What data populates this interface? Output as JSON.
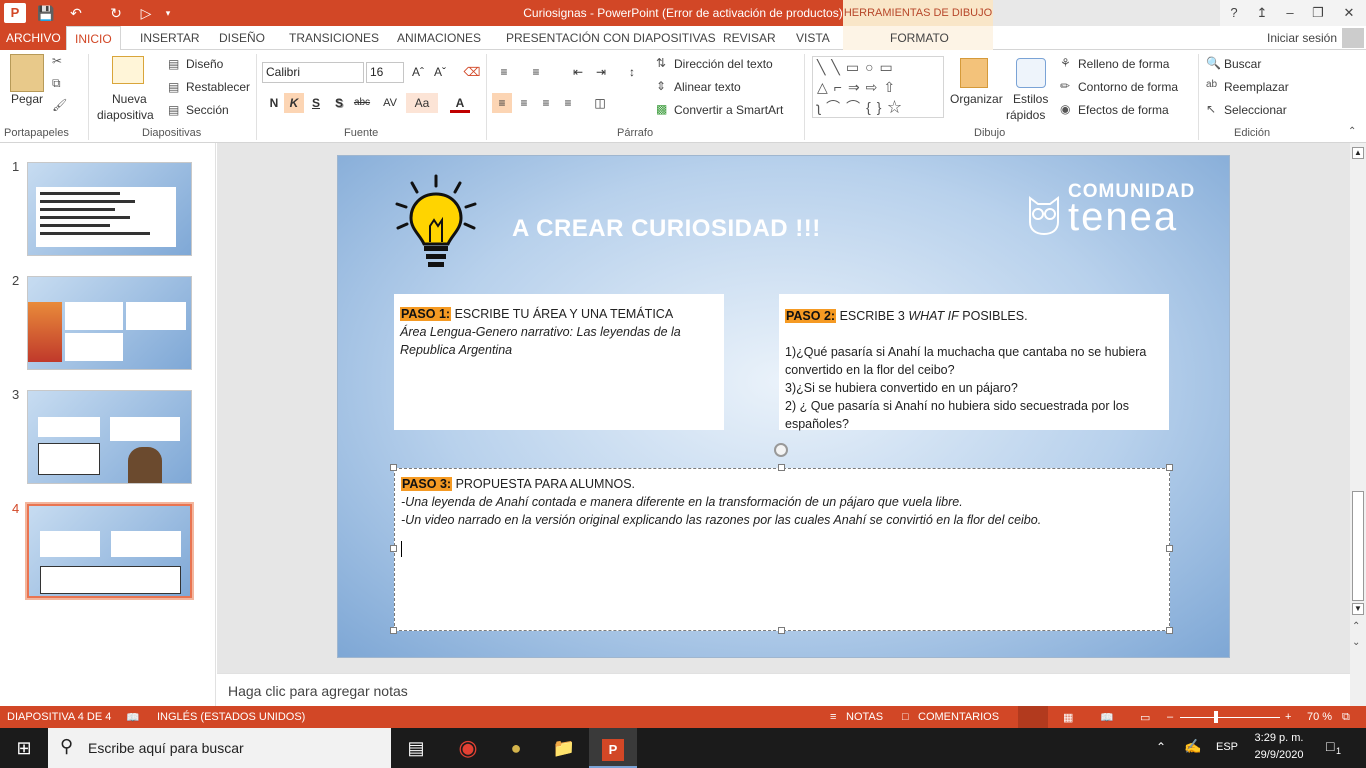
{
  "titlebar": {
    "title": "Curiosignas - PowerPoint (Error de activación de productos)",
    "context_tab": "HERRAMIENTAS DE DIBUJO",
    "help": "?",
    "min": "–",
    "restore": "❐",
    "close": "✕"
  },
  "tabs": [
    "ARCHIVO",
    "INICIO",
    "INSERTAR",
    "DISEÑO",
    "TRANSICIONES",
    "ANIMACIONES",
    "PRESENTACIÓN CON DIAPOSITIVAS",
    "REVISAR",
    "VISTA"
  ],
  "format_tab": "FORMATO",
  "signin": "Iniciar sesión",
  "ribbon": {
    "clipboard": {
      "paste": "Pegar",
      "label": "Portapapeles"
    },
    "slides": {
      "new_slide_1": "Nueva",
      "new_slide_2": "diapositiva",
      "layout": "Diseño",
      "reset": "Restablecer",
      "section": "Sección",
      "label": "Diapositivas"
    },
    "font": {
      "name": "Calibri",
      "size": "16",
      "label": "Fuente",
      "bold": "N",
      "italic": "K",
      "underline": "S",
      "shadow": "S",
      "strike": "abc",
      "case": "Aa",
      "color": "A"
    },
    "paragraph": {
      "text_dir": "Dirección del texto",
      "align_text": "Alinear texto",
      "smartart": "Convertir a SmartArt",
      "label": "Párrafo"
    },
    "drawing": {
      "arrange": "Organizar",
      "styles_1": "Estilos",
      "styles_2": "rápidos",
      "fill": "Relleno de forma",
      "outline": "Contorno de forma",
      "effects": "Efectos de forma",
      "label": "Dibujo"
    },
    "editing": {
      "find": "Buscar",
      "replace": "Reemplazar",
      "select": "Seleccionar",
      "label": "Edición"
    }
  },
  "thumbnails": [
    "1",
    "2",
    "3",
    "4"
  ],
  "slide": {
    "title": "A CREAR CURIOSIDAD !!!",
    "logo_top": "COMUNIDAD",
    "logo_bottom": "tenea",
    "box1": {
      "tag": "PASO 1:",
      "heading": " ESCRIBE TU ÁREA Y UNA TEMÁTICA",
      "body": "Área Lengua-Genero narrativo: Las leyendas de la Republica Argentina"
    },
    "box2": {
      "tag": "PASO 2:",
      "heading_1": " ESCRIBE 3 ",
      "heading_em": "WHAT IF",
      "heading_2": " POSIBLES.",
      "lines": [
        "1)¿Qué pasaría si Anahí la muchacha que cantaba no se hubiera convertido en la flor del ceibo?",
        "3)¿Si se hubiera convertido en un pájaro?",
        "2) ¿ Que pasaría si Anahí no hubiera sido secuestrada por los españoles?"
      ]
    },
    "box3": {
      "tag": "PASO 3:",
      "heading": " PROPUESTA PARA ALUMNOS.",
      "lines": [
        "-Una leyenda de Anahí contada e manera diferente en la transformación de un pájaro que vuela libre.",
        "-Un video narrado en la versión original explicando las razones por las cuales Anahí se convirtió en la flor del ceibo."
      ]
    }
  },
  "notes_placeholder": "Haga clic para agregar notas",
  "status": {
    "slide_counter": "DIAPOSITIVA 4 DE 4",
    "language": "INGLÉS (ESTADOS UNIDOS)",
    "notes": "NOTAS",
    "comments": "COMENTARIOS",
    "zoom": "70 %"
  },
  "taskbar": {
    "search_placeholder": "Escribe aquí para buscar",
    "lang": "ESP",
    "time": "3:29 p. m.",
    "date": "29/9/2020",
    "notif_count": "1"
  },
  "colors": {
    "accent": "#d24726",
    "highlight": "#f59a23",
    "format_tab_bg": "#f9e6c8"
  }
}
